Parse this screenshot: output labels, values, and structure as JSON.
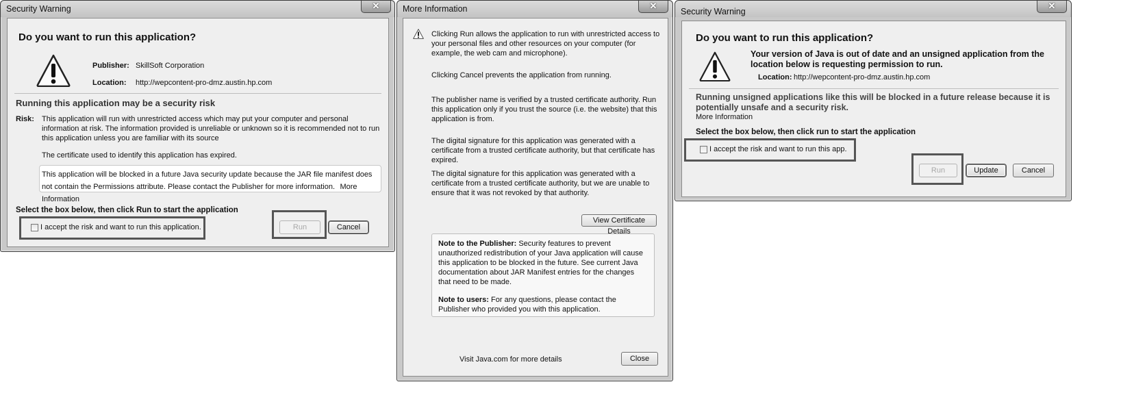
{
  "dialog1": {
    "title": "Security Warning",
    "close_symbol": "✕",
    "heading": "Do you want to run this application?",
    "publisher_label": "Publisher:",
    "publisher_value": "SkillSoft Corporation",
    "location_label": "Location:",
    "location_value": "http://wepcontent-pro-dmz.austin.hp.com",
    "risk_heading": "Running this application may be a security risk",
    "risk_label": "Risk:",
    "risk_text": "This application will run with unrestricted access which may put your computer and personal information at risk. The information provided is unreliable or unknown so it is recommended not to run this application unless you are familiar with its source",
    "cert_text": "The certificate used to identify this application has expired.",
    "notice_text": "This application will be blocked in a future Java security update because the JAR file manifest does not contain the Permissions attribute. Please contact the Publisher for more information.",
    "notice_link": "More Information",
    "select_text": "Select the box below, then click Run to start the application",
    "checkbox_label": "I accept the risk and want to run this application.",
    "run_label": "Run",
    "cancel_label": "Cancel"
  },
  "dialog2": {
    "title": "More Information",
    "close_symbol": "✕",
    "para1": "Clicking Run allows the application to run with unrestricted access to your personal files and other resources on your computer (for example, the web cam and microphone).",
    "para2": "Clicking Cancel prevents the application from running.",
    "para3": "The publisher name is verified by a trusted certificate authority. Run this application only if you trust the source (i.e. the website) that this application is from.",
    "para4": "The digital signature for this application was generated with a certificate from a trusted certificate authority, but that certificate has expired.",
    "para5": "The digital signature for this application was generated with a certificate from a trusted certificate authority, but we are unable to ensure that it was not revoked by that authority.",
    "view_cert_label": "View Certificate Details",
    "note_publisher_label": "Note to the Publisher:",
    "note_publisher_text": "Security features to prevent unauthorized redistribution of your Java application will cause this application to be blocked in the future. See current Java documentation about JAR Manifest entries for the changes that need to be made.",
    "note_users_label": "Note to users:",
    "note_users_text": "For any questions, please contact the Publisher who provided you with this application.",
    "visit_link": "Visit Java.com for more details",
    "close_label": "Close"
  },
  "dialog3": {
    "title": "Security Warning",
    "close_symbol": "✕",
    "heading": "Do you want to run this application?",
    "java_message": "Your version of Java is out of date and an unsigned application from the location below is requesting permission to run.",
    "location_label": "Location:",
    "location_value": "http://wepcontent-pro-dmz.austin.hp.com",
    "unsigned_text": "Running unsigned applications like this will be blocked in a future release because it is potentially unsafe and a security risk.",
    "more_info_link": "More Information",
    "select_text": "Select the box below, then click run to start the application",
    "checkbox_label": "I accept the risk and want to run this app.",
    "run_label": "Run",
    "update_label": "Update",
    "cancel_label": "Cancel"
  }
}
